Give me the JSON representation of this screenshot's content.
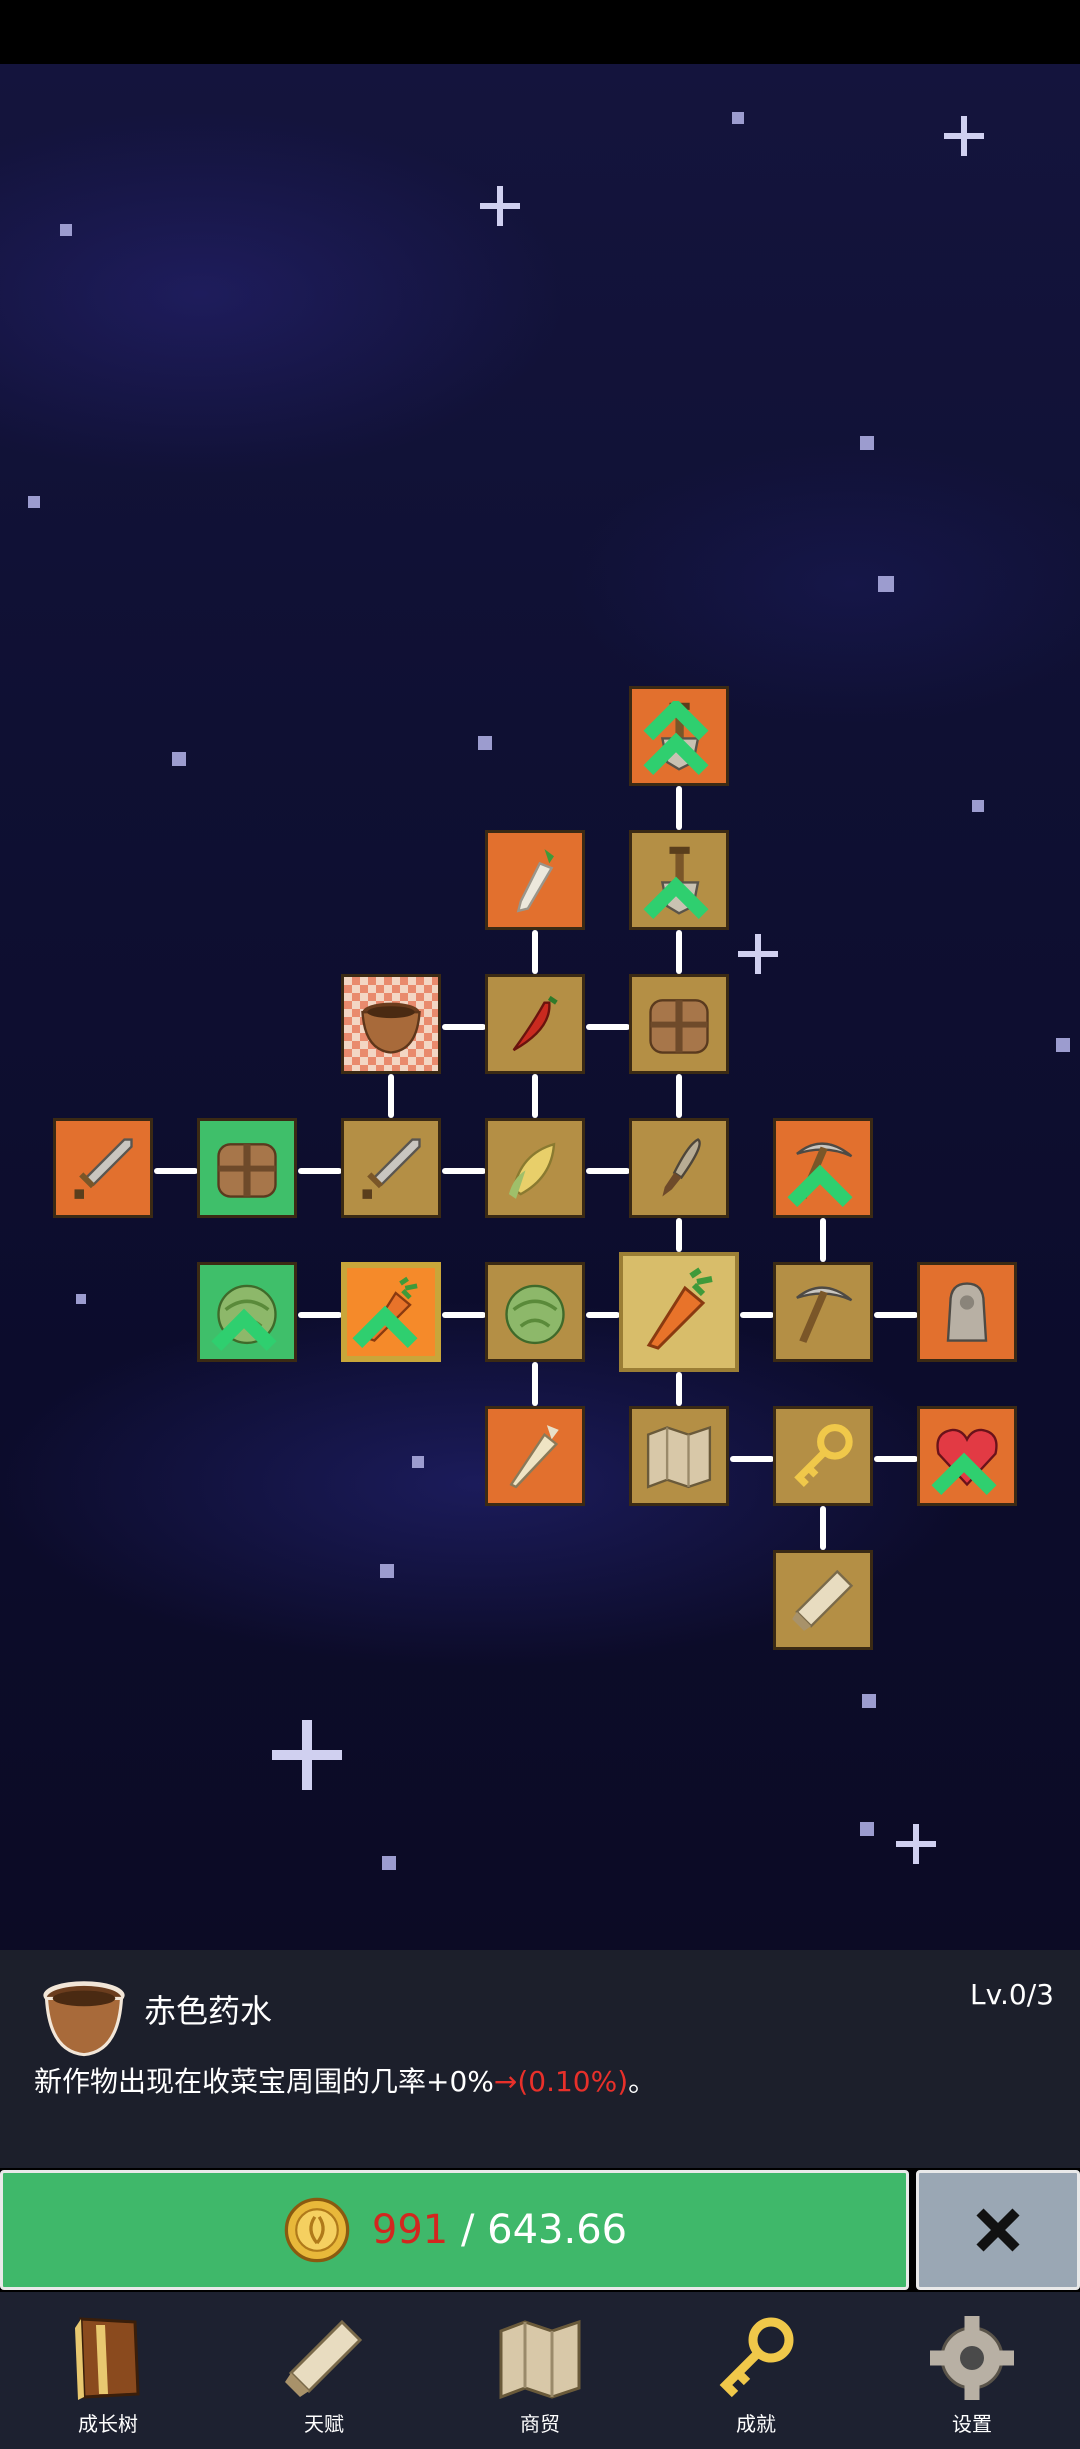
{
  "info": {
    "item_name": "赤色药水",
    "level": "Lv.0/3",
    "desc_main": "新作物出现在收菜宝周围的几率+0%",
    "desc_arrow": "→(0.10%)",
    "desc_end": "。",
    "icon": "bowl-icon"
  },
  "upgrade": {
    "have": "991",
    "separator": " / ",
    "cost": "643.66",
    "icon": "coin-icon"
  },
  "close": {
    "icon": "close-icon"
  },
  "nav": {
    "growth_tree": "成长树",
    "talent": "天赋",
    "trade": "商贸",
    "achievement": "成就",
    "settings": "设置"
  },
  "colors": {
    "node_orange": "#e2702e",
    "node_gold": "#b48f45",
    "node_green": "#3fbf6a",
    "upgrade_green": "#3fb86a",
    "price_red": "#d2271f",
    "panel": "#1c1f2b",
    "nav": "#1d2130"
  },
  "tree_nodes": [
    {
      "icon": "shovel-icon",
      "state": "orange",
      "upgradeable": true
    },
    {
      "icon": "radish-icon",
      "state": "orange"
    },
    {
      "icon": "shovel-icon",
      "state": "gold",
      "upgradeable": true
    },
    {
      "icon": "bowl-icon",
      "state": "selected-checker"
    },
    {
      "icon": "chili-icon",
      "state": "gold"
    },
    {
      "icon": "backpack-icon",
      "state": "gold"
    },
    {
      "icon": "sword-icon",
      "state": "orange"
    },
    {
      "icon": "backpack-icon",
      "state": "green"
    },
    {
      "icon": "sword-icon",
      "state": "gold"
    },
    {
      "icon": "corn-icon",
      "state": "gold"
    },
    {
      "icon": "dagger-icon",
      "state": "gold"
    },
    {
      "icon": "pickaxe-icon",
      "state": "orange",
      "upgradeable": true
    },
    {
      "icon": "cabbage-icon",
      "state": "green",
      "upgradeable": true
    },
    {
      "icon": "carrot-icon",
      "state": "orange",
      "upgradeable": true
    },
    {
      "icon": "cabbage-icon",
      "state": "gold"
    },
    {
      "icon": "carrot-icon",
      "state": "center"
    },
    {
      "icon": "pickaxe-icon",
      "state": "gold"
    },
    {
      "icon": "statue-icon",
      "state": "orange"
    },
    {
      "icon": "parsnip-icon",
      "state": "orange"
    },
    {
      "icon": "map-icon",
      "state": "gold"
    },
    {
      "icon": "key-icon",
      "state": "gold"
    },
    {
      "icon": "heart-icon",
      "state": "orange",
      "upgradeable": true
    },
    {
      "icon": "scroll-icon",
      "state": "gold"
    }
  ]
}
